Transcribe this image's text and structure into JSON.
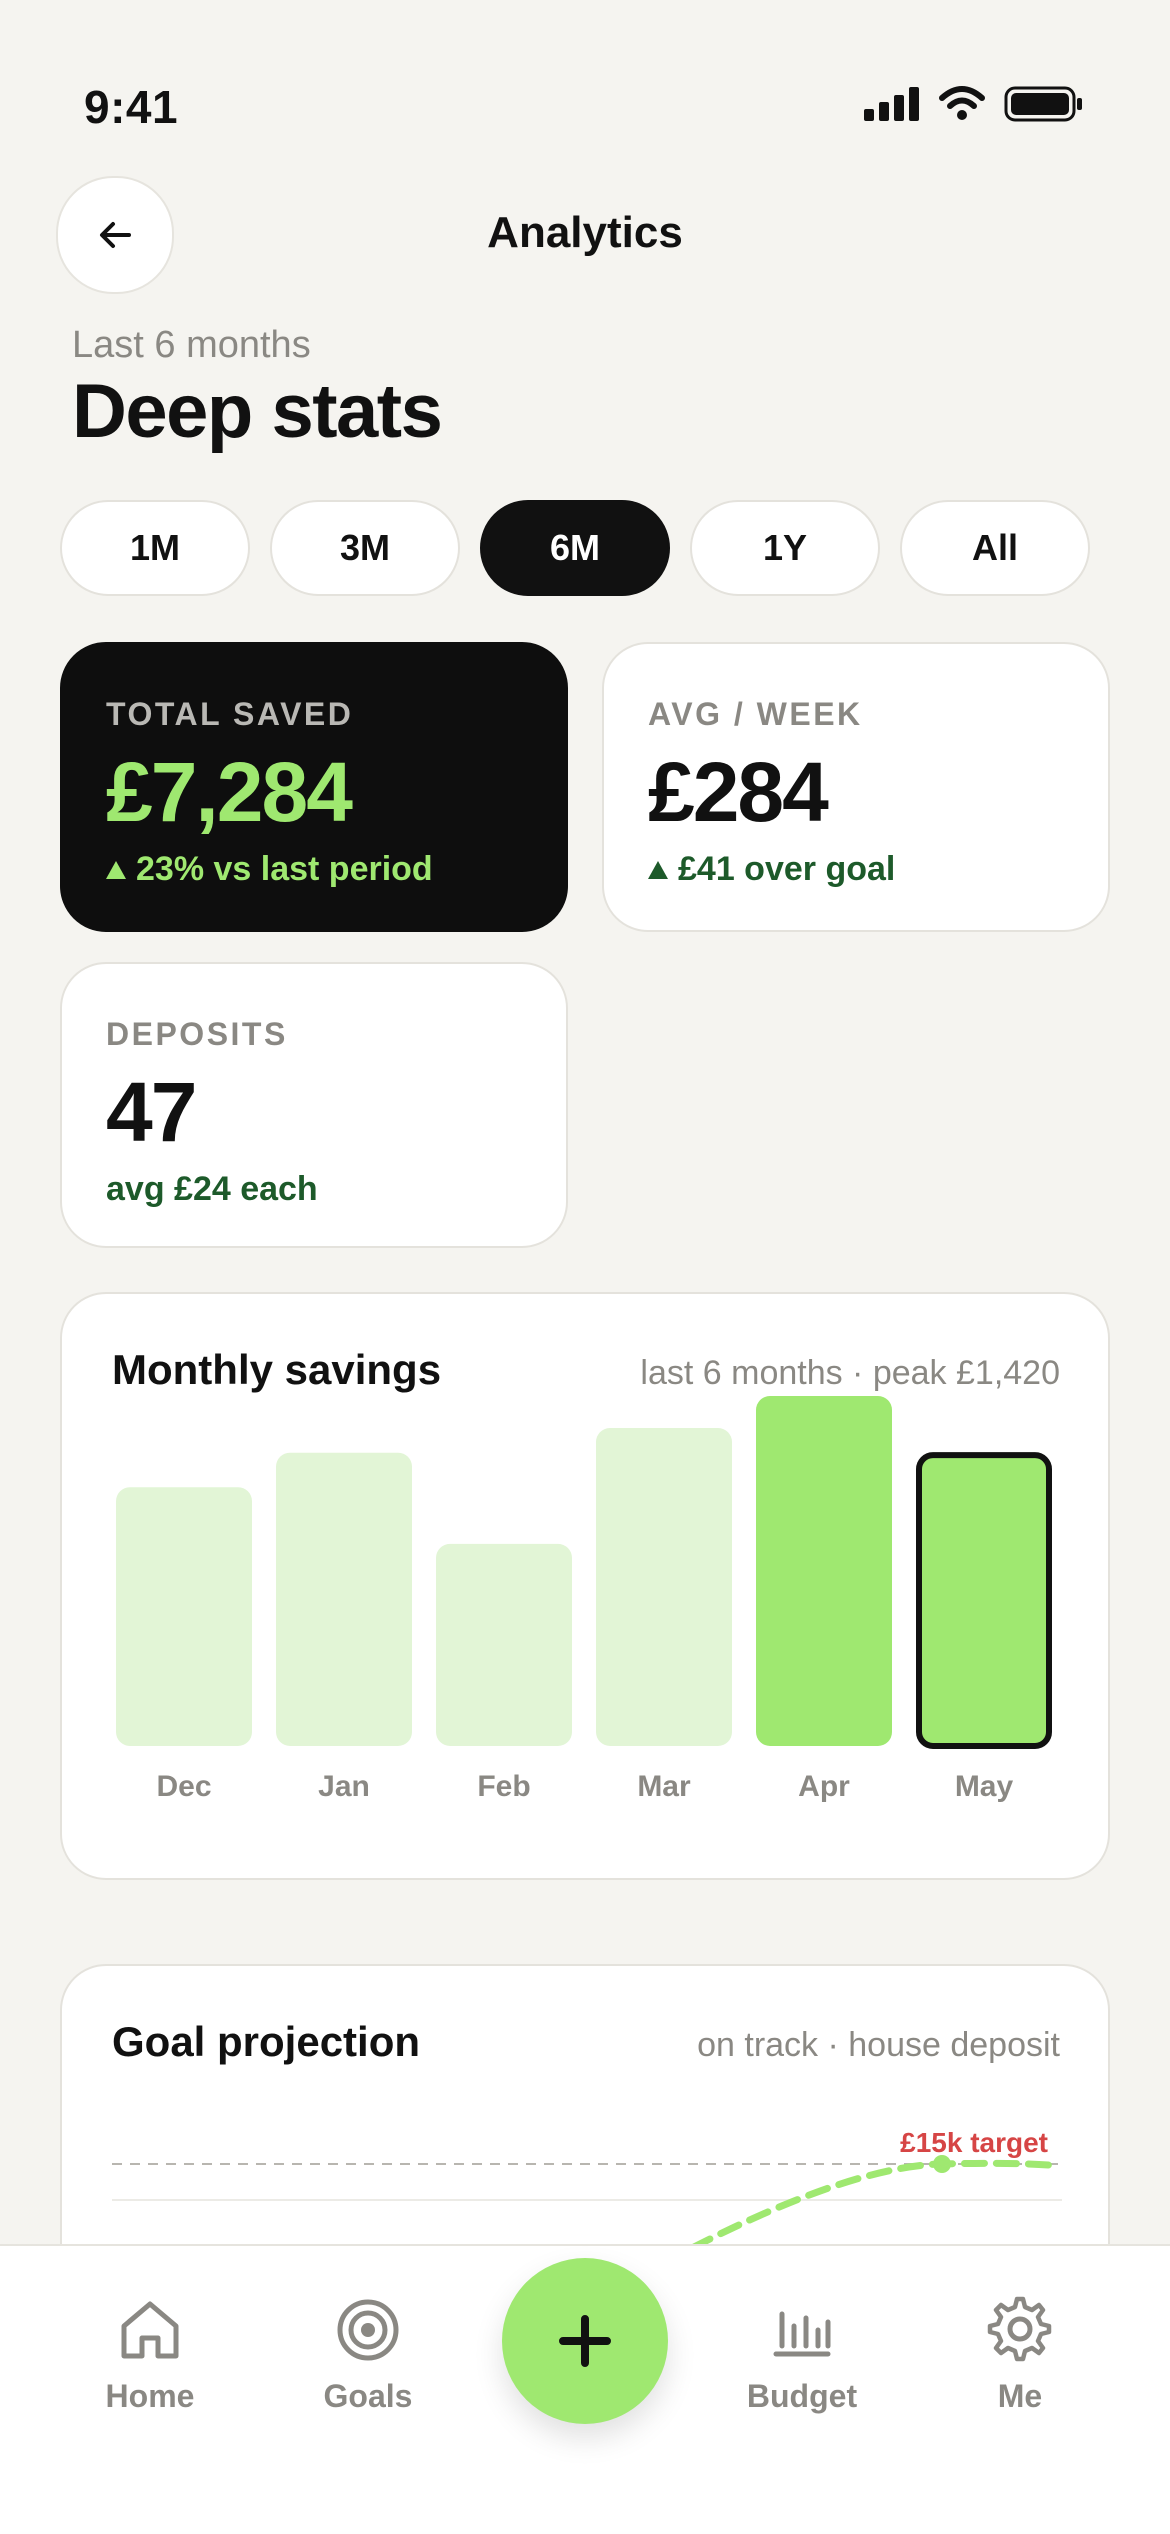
{
  "status_bar": {
    "time": "9:41"
  },
  "header": {
    "title": "Analytics"
  },
  "subtitle": "Last 6 months",
  "page_title": "Deep stats",
  "ranges": [
    {
      "label": "1M",
      "active": false
    },
    {
      "label": "3M",
      "active": false
    },
    {
      "label": "6M",
      "active": true
    },
    {
      "label": "1Y",
      "active": false
    },
    {
      "label": "All",
      "active": false
    }
  ],
  "stats": {
    "total_saved": {
      "label": "TOTAL SAVED",
      "value": "£7,284",
      "delta": "23% vs last period"
    },
    "avg_week": {
      "label": "AVG / WEEK",
      "value": "£284",
      "delta": "£41 over goal"
    },
    "deposits": {
      "label": "DEPOSITS",
      "value": "47",
      "note": "avg £24 each"
    }
  },
  "monthly_savings": {
    "title": "Monthly savings",
    "meta": "last 6 months · peak £1,420"
  },
  "chart_data": {
    "type": "bar",
    "categories": [
      "Dec",
      "Jan",
      "Feb",
      "Mar",
      "Apr",
      "May"
    ],
    "values": [
      1050,
      1190,
      820,
      1290,
      1420,
      1180
    ],
    "highlight_current": "May",
    "colors": {
      "past": "#e2f5d6",
      "recent": "#9fe870",
      "outline": "#111111"
    }
  },
  "goal_projection": {
    "title": "Goal projection",
    "meta": "on track · house deposit",
    "target_label": "£15k target",
    "target_color": "#d64545"
  },
  "tabbar": {
    "items": [
      {
        "label": "Home",
        "icon": "home-icon"
      },
      {
        "label": "Goals",
        "icon": "target-icon"
      },
      {
        "label": "Budget",
        "icon": "bar-chart-icon"
      },
      {
        "label": "Me",
        "icon": "gear-icon"
      }
    ],
    "fab_icon": "plus-icon"
  },
  "colors": {
    "accent": "#9fe870",
    "dark": "#0e0e0e",
    "positive_text": "#1d5a2a",
    "muted": "#8a8883",
    "background": "#f5f4f0"
  }
}
